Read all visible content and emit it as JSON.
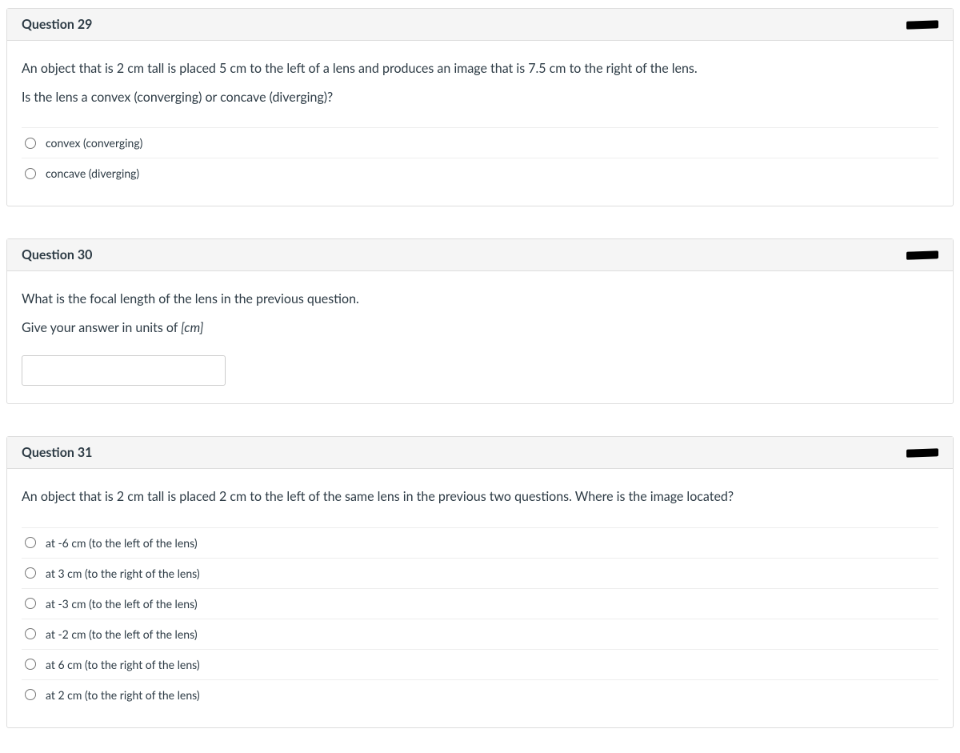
{
  "questions": [
    {
      "number": "Question 29",
      "prompt_lines": [
        "An object that is 2 cm tall is placed 5 cm to the left of a lens and produces an image that is 7.5 cm to the right of the lens.",
        "Is the lens a convex (converging) or concave (diverging)?"
      ],
      "type": "radio",
      "options": [
        "convex (converging)",
        "concave (diverging)"
      ]
    },
    {
      "number": "Question 30",
      "prompt_lines": [
        "What is the focal length of the lens in the previous question.",
        "Give your answer in units of [cm]"
      ],
      "prompt_italic_segment": "[cm]",
      "type": "text",
      "value": ""
    },
    {
      "number": "Question 31",
      "prompt_lines": [
        "An object that is 2 cm tall is placed 2 cm to the left of the same lens in the previous two questions. Where is the image located?"
      ],
      "type": "radio",
      "options": [
        "at -6 cm (to the left of the lens)",
        "at 3 cm (to the right of the lens)",
        "at -3 cm (to the left of the lens)",
        "at -2 cm (to the left of the lens)",
        "at 6 cm (to the right of the lens)",
        "at 2 cm (to the right of the lens)"
      ]
    }
  ]
}
